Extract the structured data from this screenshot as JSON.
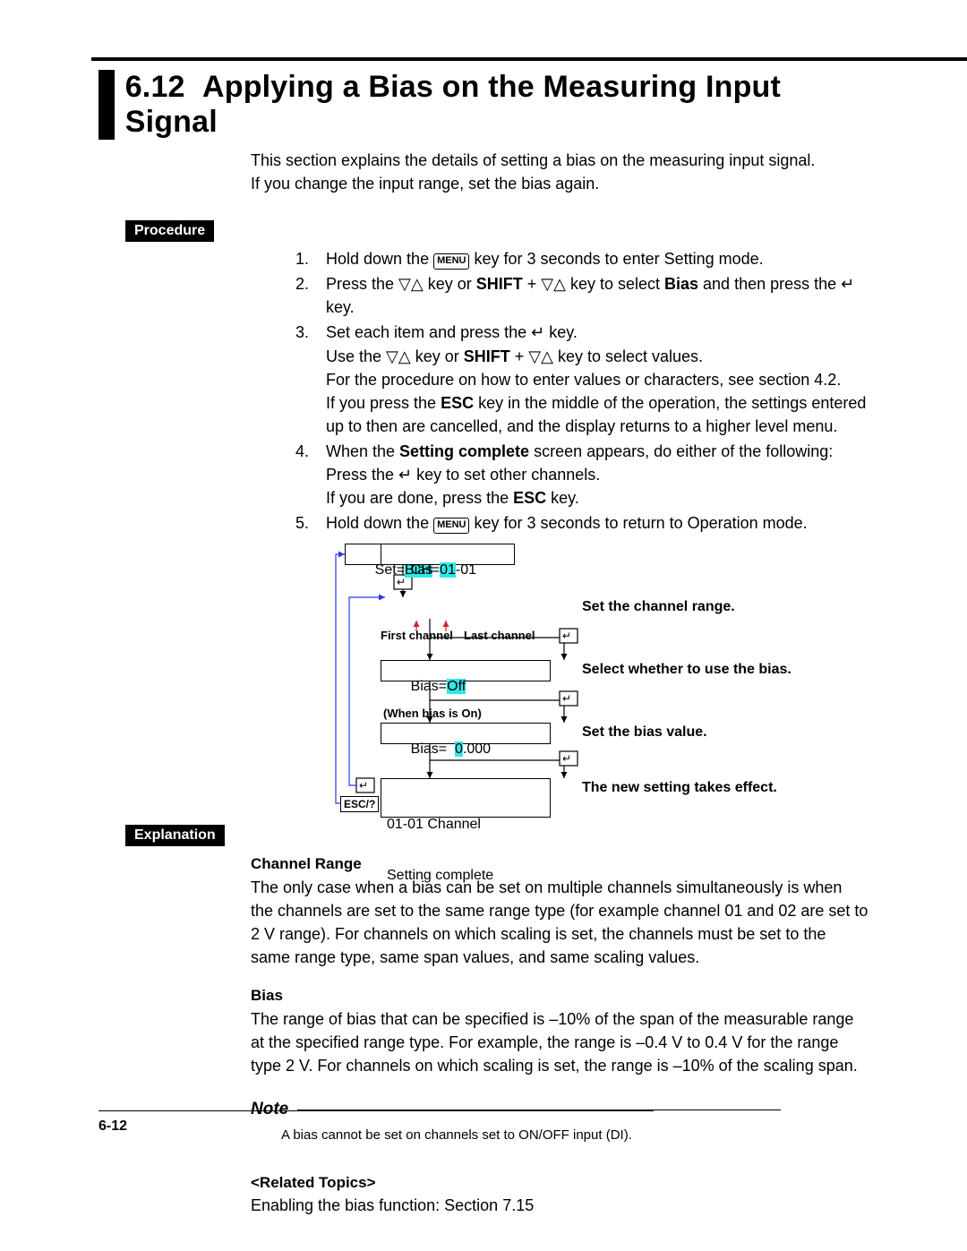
{
  "section_number": "6.12",
  "section_title": "Applying a Bias on the Measuring Input Signal",
  "intro_line1": "This section explains the details of setting a bias on the measuring input signal.",
  "intro_line2": "If you change the input range, set the bias again.",
  "labels": {
    "procedure": "Procedure",
    "explanation": "Explanation"
  },
  "keys": {
    "menu": "MENU",
    "shift": "SHIFT",
    "esc": "ESC",
    "esc_help": "ESC/?"
  },
  "procedure": {
    "step1": {
      "n": "1.",
      "a": "Hold down the ",
      "b": " key for 3 seconds to enter Setting mode."
    },
    "step2": {
      "n": "2.",
      "a": "Press the ▽△ key or ",
      "b": " + ▽△ key to select ",
      "bias": "Bias",
      "c": " and then press the ",
      "d": " key."
    },
    "step3": {
      "n": "3.",
      "a": "Set each item and press the ",
      "b": " key.",
      "c": "Use the ▽△ key or ",
      "d": " + ▽△ key to select values.",
      "e": "For the procedure on how to enter values or characters, see section 4.2.",
      "f": "If you press the ",
      "g": " key in the middle of the operation, the settings entered up to then are cancelled, and the display returns to a higher level menu."
    },
    "step4": {
      "n": "4.",
      "a": "When the ",
      "sc": "Setting complete",
      "b": " screen appears, do either of the following:",
      "c": "Press the ",
      "d": " key to set other channels.",
      "e": "If you are done, press the ",
      "f": " key."
    },
    "step5": {
      "n": "5.",
      "a": "Hold down the ",
      "b": " key for 3 seconds to return to Operation mode."
    }
  },
  "diagram": {
    "box1_a": "Set=",
    "box1_b": "Bias",
    "box2_a": "CH=",
    "box2_b": "01",
    "box2_c": "-01",
    "first_channel": "First channel",
    "last_channel": "Last channel",
    "box3_a": "Bias=",
    "box3_b": "Off",
    "when_on": "(When bias is On)",
    "box4_a": "Bias=  ",
    "box4_b": "0",
    "box4_c": ".000",
    "box5_l1": "01-01 Channel",
    "box5_l2": "Setting complete",
    "right1": "Set the channel range.",
    "right2": "Select whether to use the bias.",
    "right3": "Set the bias value.",
    "right4": "The new setting takes effect."
  },
  "explanation": {
    "ch_hdr": "Channel Range",
    "ch_body": "The only case when a bias can be set on multiple channels simultaneously is when the channels are set to the same range type (for example channel 01 and 02 are set to 2 V range).  For channels on which scaling is set, the channels must be set to the same range type, same span values, and same scaling values.",
    "bias_hdr": "Bias",
    "bias_body": "The range of bias that can be specified is –10% of the span of the measurable range at the specified range type.  For example, the range is –0.4 V to 0.4 V for the range type 2 V.  For channels on which scaling is set, the range is –10% of the scaling span.",
    "note_word": "Note",
    "note_text": "A bias cannot be set on channels set to ON/OFF input (DI).",
    "related_hdr": "<Related Topics>",
    "related_body": "Enabling the bias function: Section 7.15"
  },
  "page_number": "6-12"
}
